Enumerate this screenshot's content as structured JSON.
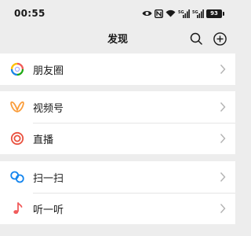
{
  "status_bar": {
    "time": "00:55",
    "battery": "93",
    "icons": [
      "eye-icon",
      "nfc-icon",
      "wifi-icon",
      "signal-5g-icon",
      "signal-5g-icon",
      "battery-icon"
    ]
  },
  "nav": {
    "title": "发现",
    "actions": [
      "search-icon",
      "add-circle-icon"
    ]
  },
  "sections": [
    {
      "items": [
        {
          "label": "朋友圈",
          "icon": "moments-icon"
        }
      ]
    },
    {
      "items": [
        {
          "label": "视频号",
          "icon": "channels-icon"
        },
        {
          "label": "直播",
          "icon": "live-icon"
        }
      ]
    },
    {
      "items": [
        {
          "label": "扫一扫",
          "icon": "scan-icon"
        },
        {
          "label": "听一听",
          "icon": "listen-icon"
        }
      ]
    }
  ],
  "colors": {
    "background": "#ededed",
    "row_background": "#ffffff",
    "text": "#191919",
    "chevron": "#b2b2b2",
    "channels_accent": "#fa9d3b",
    "live_accent": "#e9503e",
    "scan_accent": "#1485ee",
    "listen_accent": "#f15b5b"
  }
}
